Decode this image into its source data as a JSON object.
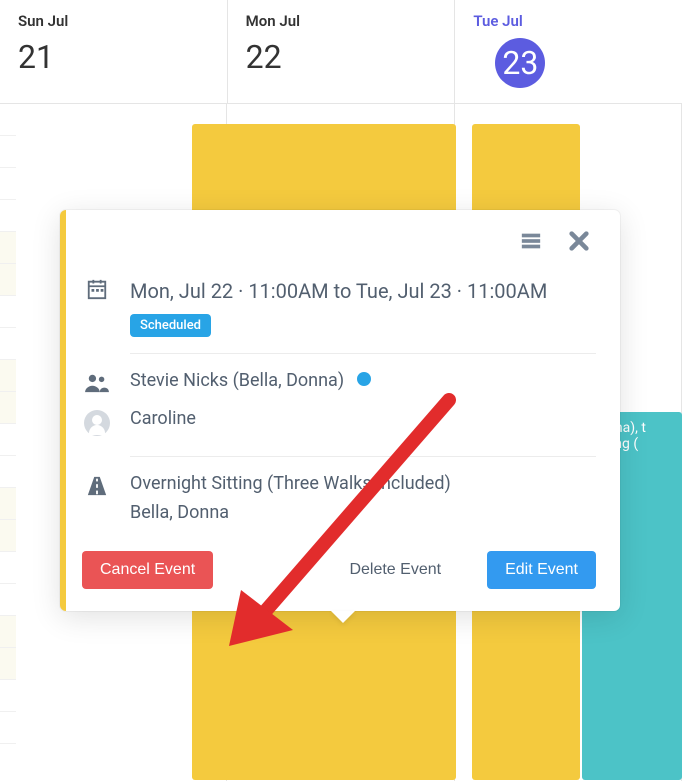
{
  "calendar": {
    "days": [
      {
        "label": "Sun Jul",
        "num": "21",
        "today": false
      },
      {
        "label": "Mon Jul",
        "num": "22",
        "today": false
      },
      {
        "label": "Tue Jul",
        "num": "23",
        "today": true
      }
    ],
    "teal_event_text": "Donna), t Sitting ("
  },
  "popover": {
    "datetime": "Mon, Jul 22 · 11:00AM to Tue, Jul 23 · 11:00AM",
    "status_badge": "Scheduled",
    "client_text": "Stevie Nicks (Bella, Donna)",
    "sitter": "Caroline",
    "service": "Overnight Sitting (Three Walks Included)",
    "pets": "Bella, Donna",
    "buttons": {
      "cancel": "Cancel Event",
      "delete": "Delete Event",
      "edit": "Edit Event"
    }
  },
  "colors": {
    "brand_purple": "#5c5ce0",
    "event_yellow": "#f4ca3e",
    "event_teal": "#4cc3c7",
    "badge_blue": "#28a4e6",
    "danger": "#ea5455",
    "primary": "#339af0",
    "arrow_red": "#e22c2c"
  }
}
